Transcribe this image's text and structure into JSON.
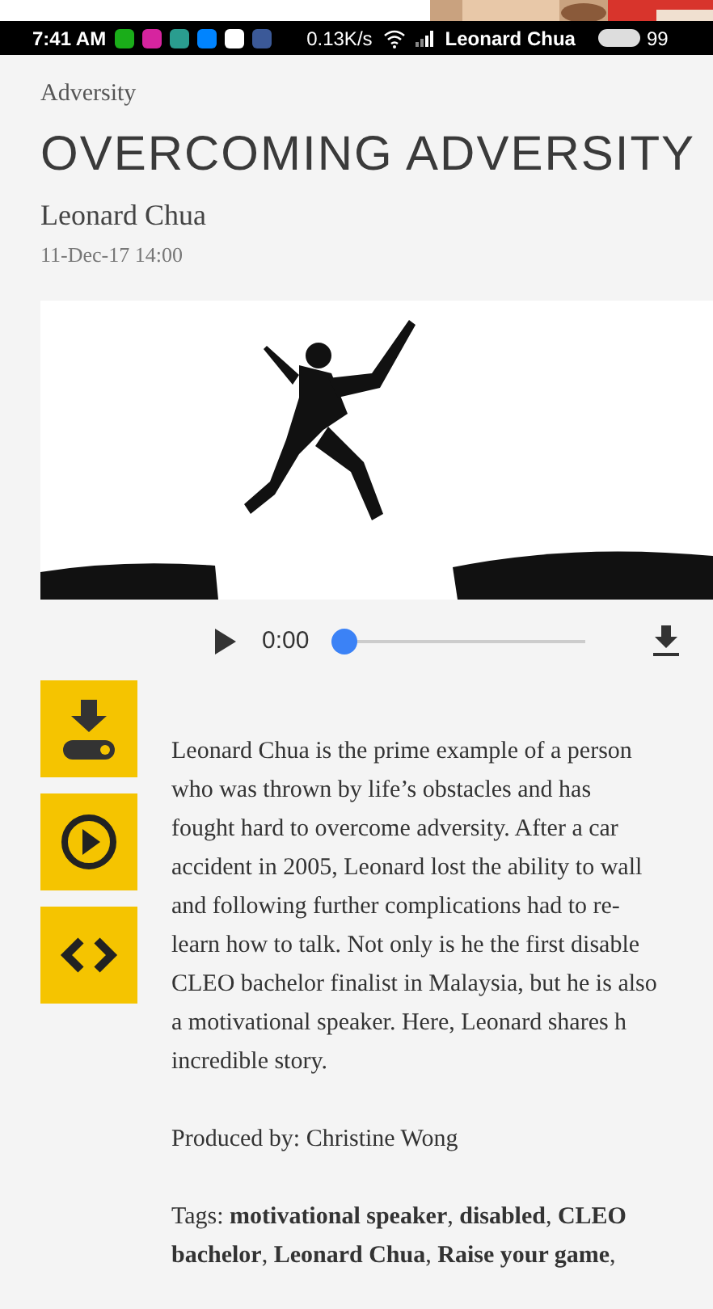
{
  "status_bar": {
    "time": "7:41 AM",
    "speed": "0.13K/s",
    "carrier": "Leonard Chua",
    "battery": "99"
  },
  "category": "Adversity",
  "title": "OVERCOMING ADVERSITY",
  "author": "Leonard Chua",
  "date": "11-Dec-17 14:00",
  "audio_player": {
    "time": "0:00",
    "level": 0
  },
  "side_buttons": [
    {
      "kind": "download"
    },
    {
      "kind": "play"
    },
    {
      "kind": "embed"
    }
  ],
  "body": "Leonard Chua is the prime example of a person\nwho was thrown by life’s obstacles and has\nfought hard to overcome adversity. After a car\naccident in 2005, Leonard lost the ability to wall\nand following further complications had to re-\nlearn how to talk. Not only is he the first disable\nCLEO bachelor finalist in Malaysia, but he is also\na motivational speaker. Here, Leonard shares h\nincredible story.",
  "producer": "Produced by: Christine Wong",
  "tags": "Tags: **motivational speaker**, **disabled**, **CLEO**\n**bachelor**, **Leonard Chua**, **Raise your game**,"
}
